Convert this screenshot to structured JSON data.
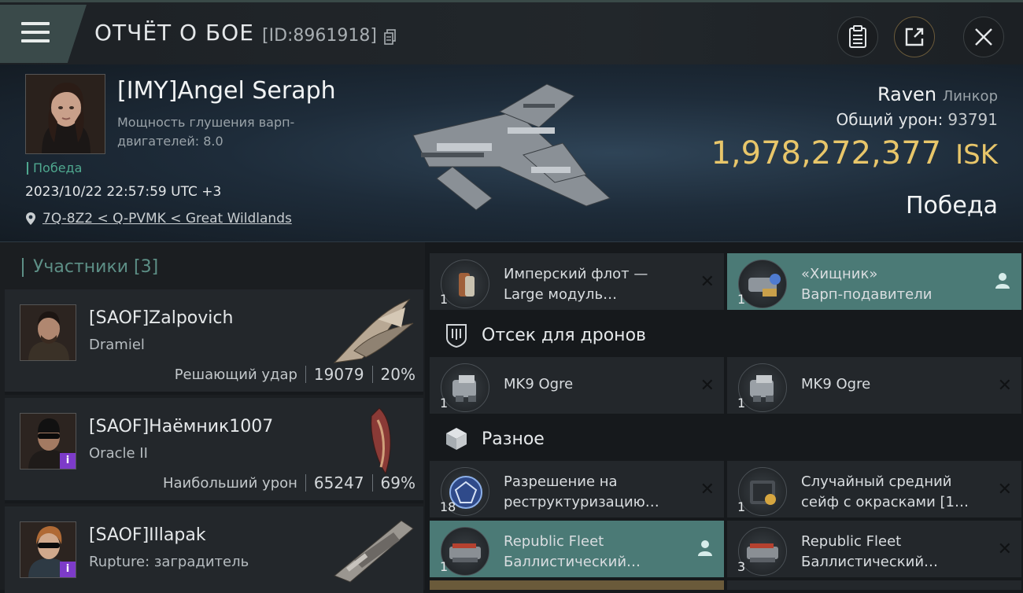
{
  "header": {
    "title": "ОТЧЁТ О БОЕ",
    "report_id": "[ID:8961918]",
    "icons": [
      "menu-icon",
      "copy-icon",
      "clipboard-icon",
      "share-icon",
      "close-icon"
    ]
  },
  "victim": {
    "name": "[IMY]Angel Seraph",
    "subtitle": "Мощность глушения варп-двигателей: 8.0",
    "result_tag": "Победа",
    "datetime": "2023/10/22 22:57:59 UTC +3",
    "location": "7Q-8Z2 < Q-PVMK < Great Wildlands",
    "ship": "Raven",
    "ship_class": "Линкор",
    "total_damage_label": "Общий урон:",
    "total_damage": "93791",
    "isk_value": "1,978,272,377",
    "currency": "ISK",
    "outcome": "Победа"
  },
  "participants": {
    "title": "Участники [3]",
    "rows": [
      {
        "name": "[SAOF]Zalpovich",
        "ship": "Dramiel",
        "stat_label": "Решающий удар",
        "damage": "19079",
        "percent": "20%",
        "has_badge": false
      },
      {
        "name": "[SAOF]Наёмник1007",
        "ship": "Oracle II",
        "stat_label": "Наибольший урон",
        "damage": "65247",
        "percent": "69%",
        "has_badge": true
      },
      {
        "name": "[SAOF]Illapak",
        "ship": "Rupture: заградитель",
        "stat_label": "",
        "damage": "",
        "percent": "",
        "has_badge": true
      }
    ]
  },
  "items": {
    "top_left": {
      "name_1": "Имперский флот —",
      "name_2": "Large модуль…",
      "qty": "1"
    },
    "top_right": {
      "name_1": "«Хищник»",
      "name_2": "Варп-подавители",
      "qty": "1"
    },
    "drone_bay_title": "Отсек для дронов",
    "drone_left": {
      "name": "MK9 Ogre",
      "qty": "1"
    },
    "drone_right": {
      "name": "MK9 Ogre",
      "qty": "1"
    },
    "misc_title": "Разное",
    "misc_1": {
      "name_1": "Разрешение на",
      "name_2": "реструктуризацию…",
      "qty": "18"
    },
    "misc_2": {
      "name_1": "Случайный средний",
      "name_2": "сейф с окрасками [1…",
      "qty": "1"
    },
    "misc_3": {
      "name_1": "Republic Fleet",
      "name_2": "Баллистический…",
      "qty": "1"
    },
    "misc_4": {
      "name_1": "Republic Fleet",
      "name_2": "Баллистический…",
      "qty": "3"
    }
  },
  "colors": {
    "accent": "#4b7a76",
    "isk": "#e8c66a",
    "victory": "#4fa88f",
    "badge": "#7d3bc9"
  }
}
